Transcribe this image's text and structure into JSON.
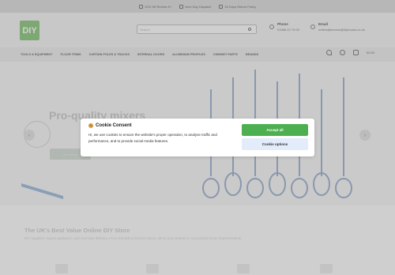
{
  "topbar": {
    "promos": [
      {
        "icon": "tag-icon",
        "text": "10% Off Review 5+"
      },
      {
        "icon": "truck-icon",
        "text": "Next Day Dispatch"
      },
      {
        "icon": "return-icon",
        "text": "30 Days Return Policy"
      }
    ]
  },
  "header": {
    "logo_text": "DIY",
    "search_placeholder": "Search",
    "phone": {
      "label": "Phone",
      "value": "01568 22 75 00"
    },
    "email": {
      "label": "Email",
      "value": "orders@service@diyhouse.co.uk"
    }
  },
  "nav": {
    "items": [
      "TOOLS & EQUIPMENT",
      "FLOOR TRIMS",
      "CURTAIN POLES & TRACKS",
      "INTERNAL DOORS",
      "ALUMINIUM PROFILES",
      "CHIMNEY PARTS",
      "BRANDS"
    ],
    "basket_total": "£0.00"
  },
  "hero": {
    "title": "Pro-quality mixers",
    "cta": "Get Mixing"
  },
  "intro": {
    "tagline": "The UK's Best Value Online DIY Store",
    "subtag": "DIY supplies, expert guidance, and next-day delivery. From threads to bronze doors, we're your partner in successful home improvements."
  },
  "cookie": {
    "title": "Cookie Consent",
    "text": "Hi, we use cookies to ensure the website's proper operation, to analyse traffic and performance, and to provide social media features.",
    "accept_label": "Accept all",
    "options_label": "Cookie options",
    "accent": "#4caf50"
  }
}
